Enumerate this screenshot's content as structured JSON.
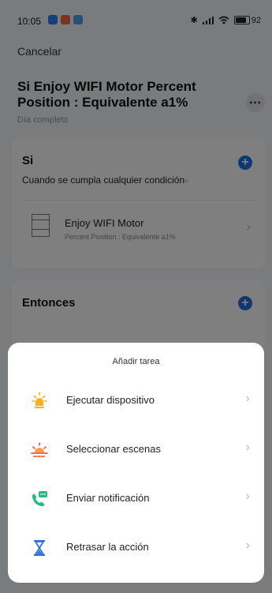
{
  "status_bar": {
    "time": "10:05",
    "battery_percent": 92,
    "battery_label": "92"
  },
  "header": {
    "cancel_label": "Cancelar",
    "title": "Si Enjoy WIFI Motor Percent Position : Equivalente a1%",
    "subtitle": "Día completo",
    "more_label": "•••"
  },
  "if_section": {
    "title": "Si",
    "add_label": "+",
    "condition_text": "Cuando se cumpla cualquier condición",
    "device": {
      "name": "Enjoy WIFI Motor",
      "detail": "Percent Position : Equivalente a1%"
    }
  },
  "then_section": {
    "title": "Entonces",
    "add_label": "+"
  },
  "sheet": {
    "title": "Añadir tarea",
    "items": [
      {
        "label": "Ejecutar dispositivo",
        "icon": "bulb-icon"
      },
      {
        "label": "Seleccionar escenas",
        "icon": "sunrise-icon"
      },
      {
        "label": "Enviar notificación",
        "icon": "notification-phone-icon"
      },
      {
        "label": "Retrasar la acción",
        "icon": "hourglass-icon"
      }
    ]
  },
  "colors": {
    "accent_blue": "#1e6fe0",
    "bulb_orange": "#f7b21a",
    "sunrise_red": "#f5573b",
    "notify_green": "#1fbd84",
    "hourglass_blue": "#2f6fde"
  }
}
